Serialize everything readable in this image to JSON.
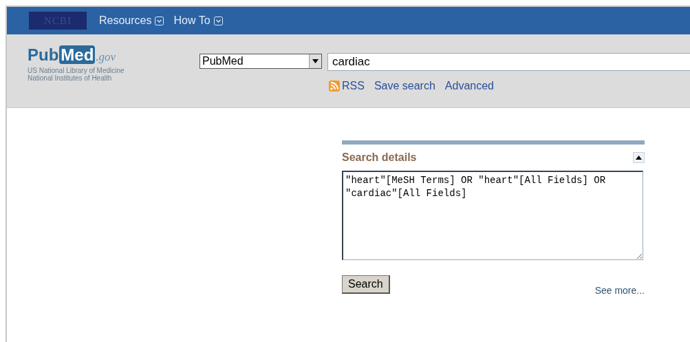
{
  "topbar": {
    "logo": "NCBI",
    "menus": [
      {
        "label": "Resources"
      },
      {
        "label": "How To"
      }
    ]
  },
  "header": {
    "brand": {
      "pub": "Pub",
      "med": "Med",
      "gov": ".gov"
    },
    "subtitle": [
      "US National Library of Medicine",
      "National Institutes of Health"
    ],
    "database": "PubMed",
    "query": "cardiac",
    "links": [
      {
        "label": "RSS",
        "kind": "rss"
      },
      {
        "label": "Save search",
        "kind": "plain"
      },
      {
        "label": "Advanced",
        "kind": "plain"
      }
    ]
  },
  "details": {
    "title": "Search details",
    "query": "\"heart\"[MeSH Terms] OR \"heart\"[All Fields] OR \"cardiac\"[All Fields]",
    "button": "Search",
    "more": "See more..."
  }
}
